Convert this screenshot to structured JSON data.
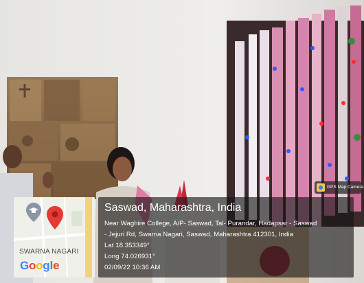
{
  "overlay": {
    "map_label": "SWARNA NAGARI",
    "map_brand": "Google",
    "title": "Saswad, Maharashtra, India",
    "address_line1": "Near Waghire College, A/P- Saswad, Tal- Purandar, Hadapsar - Saswad",
    "address_line2": "- Jejuri Rd, Swarna Nagari, Saswad, Maharashtra 412301, India",
    "lat": "Lat 18.353349°",
    "long": "Long 74.026931°",
    "datetime": "02/09/22 10:36 AM"
  },
  "badge": {
    "label": "GPS Map Camera"
  },
  "colors": {
    "wall": "#ecebe8",
    "mural": "#8a6a48",
    "curtain": "#3a2a2c",
    "marker": "#e53935",
    "google_blue": "#4285f4",
    "google_red": "#ea4335",
    "google_yellow": "#fbbc05",
    "google_green": "#34a853"
  },
  "icons": [
    "map-pin-icon",
    "graduation-cap-icon",
    "gps-camera-icon"
  ]
}
